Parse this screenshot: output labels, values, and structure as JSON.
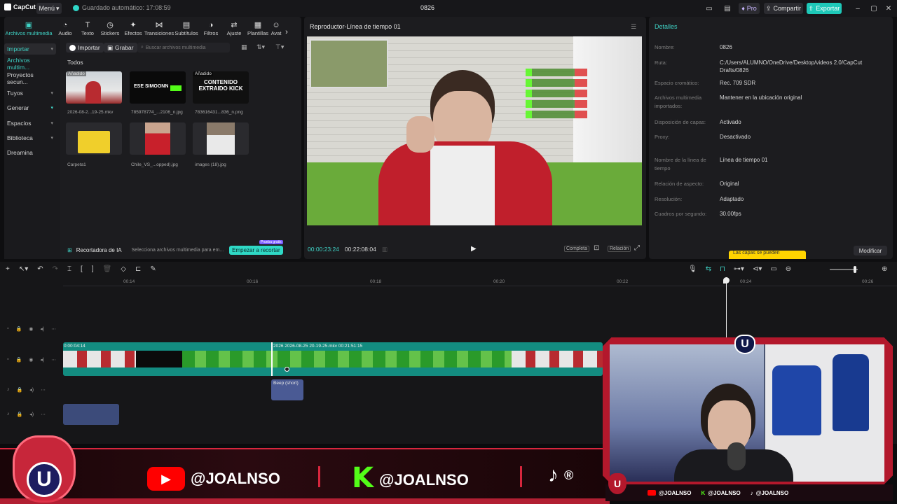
{
  "titlebar": {
    "app_name": "CapCut",
    "menu_label": "Menú",
    "autosave": "Guardado automático: 17:08:59",
    "project": "0826",
    "pro_label": "Pro",
    "share_label": "Compartir",
    "export_label": "Exportar",
    "export_color": "#1ec8b8"
  },
  "toolbar": {
    "tools": [
      {
        "label": "Archivos multimedia",
        "icon": "media-icon"
      },
      {
        "label": "Audio",
        "icon": "audio-icon"
      },
      {
        "label": "Texto",
        "icon": "text-icon"
      },
      {
        "label": "Stickers",
        "icon": "sticker-icon"
      },
      {
        "label": "Efectos",
        "icon": "effects-icon"
      },
      {
        "label": "Transiciones",
        "icon": "transition-icon"
      },
      {
        "label": "Subtítulos",
        "icon": "subtitle-icon"
      },
      {
        "label": "Filtros",
        "icon": "filter-icon"
      },
      {
        "label": "Ajuste",
        "icon": "adjust-icon"
      },
      {
        "label": "Plantillas",
        "icon": "template-icon"
      },
      {
        "label": "Avat",
        "icon": "avatar-icon"
      }
    ]
  },
  "sidenav": {
    "items": [
      {
        "label": "Importar",
        "chevron": true
      },
      {
        "label": "Archivos multim..."
      },
      {
        "label": "Proyectos secun..."
      },
      {
        "label": "Tuyos",
        "chevron": true
      },
      {
        "label": "Generar",
        "chevron": true
      },
      {
        "label": "Espacios",
        "chevron": true
      },
      {
        "label": "Biblioteca",
        "chevron": true
      },
      {
        "label": "Dreamina"
      }
    ]
  },
  "media": {
    "import_btn": "Importar",
    "record_btn": "Grabar",
    "search_placeholder": "Buscar archivos multimedia",
    "section": "Todos",
    "added_tag": "Añadido",
    "files": [
      {
        "name": "2026-08-2...19-25.mkv",
        "added": true
      },
      {
        "name": "785978774_...2106_n.jpg",
        "added": false,
        "thumb_text": "ESE SIMOONN"
      },
      {
        "name": "783616431...836_n.png",
        "added": true,
        "thumb_text": "CONTENIDO EXTRAIDO KICK"
      },
      {
        "name": "Carpeta1",
        "added": false
      },
      {
        "name": "Chile_VS_...opped).jpg",
        "added": false
      },
      {
        "name": "images (18).jpg",
        "added": false
      }
    ],
    "recorder_label": "Recortadora de IA",
    "recorder_hint": "Selecciona archivos multimedia para em...",
    "recorder_btn": "Empezar a recortar",
    "recorder_badge": "Prueba gratis"
  },
  "player": {
    "title": "Reproductor-Línea de tiempo 01",
    "current_time": "00:00:23:24",
    "total_time": "00:22:08:04",
    "full_label": "Completa",
    "ratio_label": "Relación"
  },
  "details": {
    "header": "Detalles",
    "rows": [
      {
        "label": "Nombre:",
        "value": "0826"
      },
      {
        "label": "Ruta:",
        "value": "C:/Users/ALUMNO/OneDrive/Desktop/videos 2.0/CapCut Drafts/0826"
      },
      {
        "label": "Espacio cromático:",
        "value": "Rec. 709 SDR"
      },
      {
        "label": "Archivos multimedia importados:",
        "value": "Mantener en la ubicación original"
      },
      {
        "label": "Disposición de capas:",
        "value": "Activado"
      },
      {
        "label": "Proxy:",
        "value": "Desactivado"
      },
      {
        "label": "Nombre de la línea de tiempo",
        "value": "Línea de tiempo 01"
      },
      {
        "label": "Relación de aspecto:",
        "value": "Original"
      },
      {
        "label": "Resolución:",
        "value": "Adaptado"
      },
      {
        "label": "Cuadros por segundo:",
        "value": "30.00fps"
      }
    ],
    "modify_btn": "Modificar",
    "tooltip": "Las capas se pueden"
  },
  "timeline": {
    "ruler": [
      "00:14",
      "00:16",
      "00:18",
      "00:20",
      "00:22",
      "00:24",
      "00:26"
    ],
    "clip1_time": "0:00:04:14",
    "clip2_label": "2026   2026-08-25 20-19-25.mkv   00:21:51:15",
    "audio_clip": "Beep (short)"
  },
  "overlay": {
    "handle": "@JOALNSO",
    "brand_color": "#d7263d",
    "footer_handles": [
      "@JOALNSO",
      "@JOALNSO",
      "@JOALNSO"
    ]
  }
}
